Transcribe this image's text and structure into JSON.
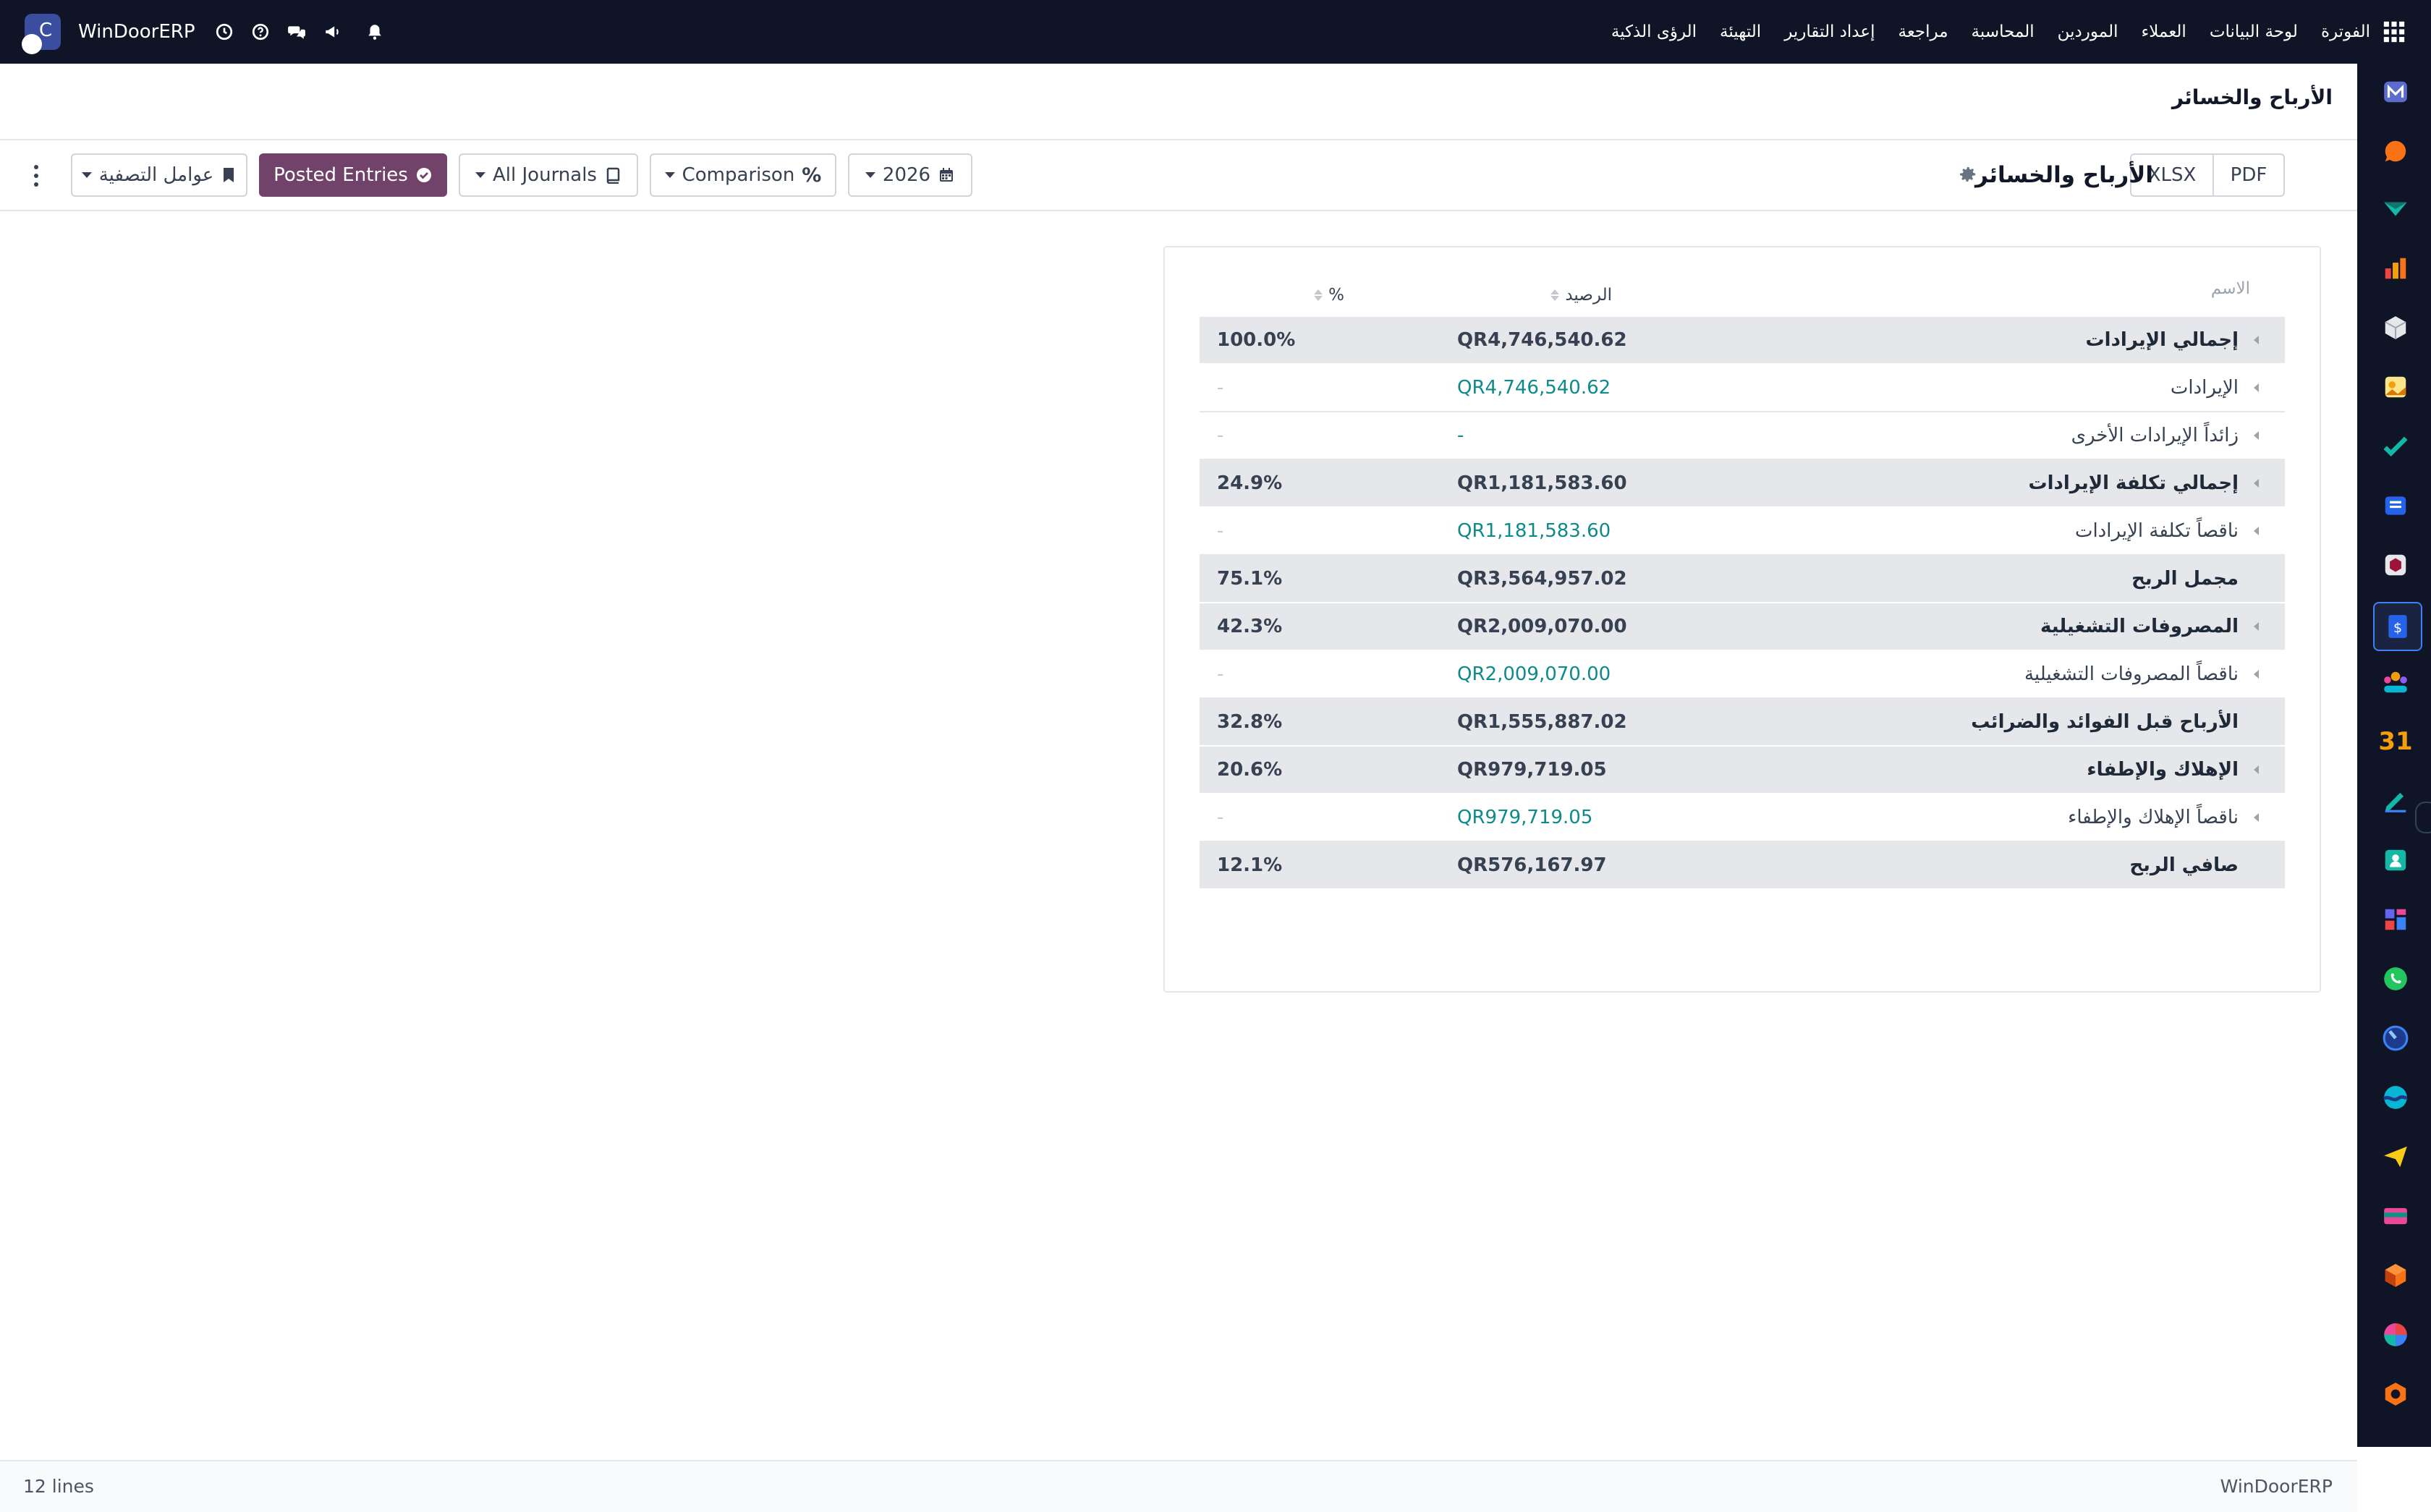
{
  "topbar": {
    "brand": "WinDoorERP",
    "menu": [
      "الفوترة",
      "لوحة البيانات",
      "العملاء",
      "الموردين",
      "المحاسبة",
      "مراجعة",
      "إعداد التقارير",
      "التهيئة",
      "الرؤى الذكية"
    ]
  },
  "page": {
    "title": "الأرباح والخسائر"
  },
  "controls": {
    "pdf": "PDF",
    "xlsx": "XLSX",
    "report_name": "الأرباح والخسائر",
    "date_filter": "2026",
    "comparison": "Comparison",
    "journals": "All Journals",
    "posted": "Posted Entries",
    "filters": "عوامل التصفية"
  },
  "table": {
    "headers": {
      "name": "الاسم",
      "balance": "الرصيد",
      "percent": "%"
    },
    "rows": [
      {
        "label": "إجمالي الإيرادات",
        "balance": "QR4,746,540.62",
        "percent": "100.0%",
        "type": "total"
      },
      {
        "label": "الإيرادات",
        "balance": "QR4,746,540.62",
        "percent": "-",
        "type": "sub"
      },
      {
        "label": "زائداً الإيرادات الأخرى",
        "balance": "-",
        "percent": "-",
        "type": "sub"
      },
      {
        "label": "إجمالي تكلفة الإيرادات",
        "balance": "QR1,181,583.60",
        "percent": "24.9%",
        "type": "total"
      },
      {
        "label": "ناقصاً تكلفة الإيرادات",
        "balance": "QR1,181,583.60",
        "percent": "-",
        "type": "sub"
      },
      {
        "label": "مجمل الربح",
        "balance": "QR3,564,957.02",
        "percent": "75.1%",
        "type": "total"
      },
      {
        "label": "المصروفات التشغيلية",
        "balance": "QR2,009,070.00",
        "percent": "42.3%",
        "type": "total"
      },
      {
        "label": "ناقصاً المصروفات التشغيلية",
        "balance": "QR2,009,070.00",
        "percent": "-",
        "type": "sub"
      },
      {
        "label": "الأرباح قبل الفوائد والضرائب",
        "balance": "QR1,555,887.02",
        "percent": "32.8%",
        "type": "total"
      },
      {
        "label": "الإهلاك والإطفاء",
        "balance": "QR979,719.05",
        "percent": "20.6%",
        "type": "total"
      },
      {
        "label": "ناقصاً الإهلاك والإطفاء",
        "balance": "QR979,719.05",
        "percent": "-",
        "type": "sub"
      },
      {
        "label": "صافي الربح",
        "balance": "QR576,167.97",
        "percent": "12.1%",
        "type": "total"
      }
    ]
  },
  "footer": {
    "lines": "12 lines",
    "company": "WinDoorERP"
  },
  "colors": {
    "navbar": "#0f1526",
    "primary": "#71426a",
    "link": "#0e8a8a",
    "total_row": "#e5e7eb"
  },
  "rail_icons": [
    "mail-icon",
    "chat-bubble-icon",
    "discount-icon",
    "bar-chart-icon",
    "cube-icon",
    "photo-icon",
    "check-icon",
    "book-icon",
    "box-icon",
    "invoice-icon",
    "team-icon",
    "calendar-31-icon",
    "pen-icon",
    "contact-icon",
    "dashboard-icon",
    "whatsapp-icon",
    "clock-icon",
    "wave-icon",
    "send-icon",
    "card-icon",
    "hexagon-icon",
    "pie-icon",
    "settings-hex-icon"
  ]
}
